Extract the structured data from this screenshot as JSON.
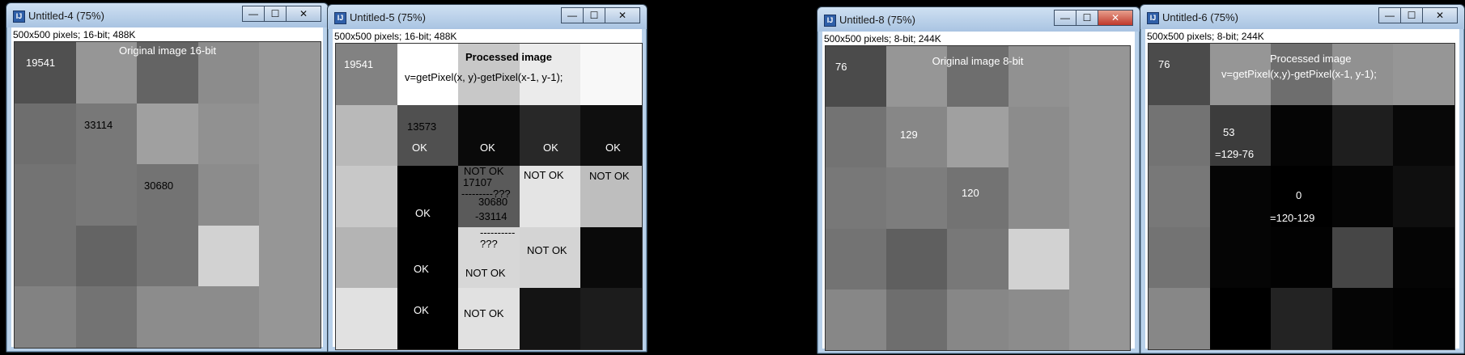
{
  "windows": [
    {
      "key": "w4",
      "title": "Untitled-4 (75%)",
      "info": "500x500 pixels; 16-bit; 488K",
      "labels": [
        "19541",
        "Original image 16-bit",
        "33114",
        "30680"
      ]
    },
    {
      "key": "w5",
      "title": "Untitled-5 (75%)",
      "info": "500x500 pixels; 16-bit; 488K",
      "labels": [
        "19541",
        "Processed image",
        "v=getPixel(x, y)-getPixel(x-1, y-1);",
        "13573",
        "OK",
        "OK",
        "OK",
        "OK",
        "NOT OK",
        "17107",
        "---------???",
        "30680",
        "-33114",
        "NOT OK",
        "NOT OK",
        "OK",
        "----------",
        "???",
        "NOT OK",
        "NOT OK",
        "OK",
        "OK",
        "NOT OK"
      ]
    },
    {
      "key": "w8",
      "title": "Untitled-8 (75%)",
      "info": "500x500 pixels; 8-bit; 244K",
      "labels": [
        "76",
        "Original image 8-bit",
        "129",
        "120"
      ]
    },
    {
      "key": "w6",
      "title": "Untitled-6 (75%)",
      "info": "500x500 pixels; 8-bit; 244K",
      "labels": [
        "76",
        "Processed image",
        "v=getPixel(x,y)-getPixel(x-1, y-1);",
        "53",
        "=129-76",
        "0",
        "=120-129"
      ]
    }
  ],
  "window_buttons": {
    "minimize": "—",
    "maximize": "☐",
    "close": "✕"
  },
  "icons": {
    "window": "imagej-icon"
  }
}
